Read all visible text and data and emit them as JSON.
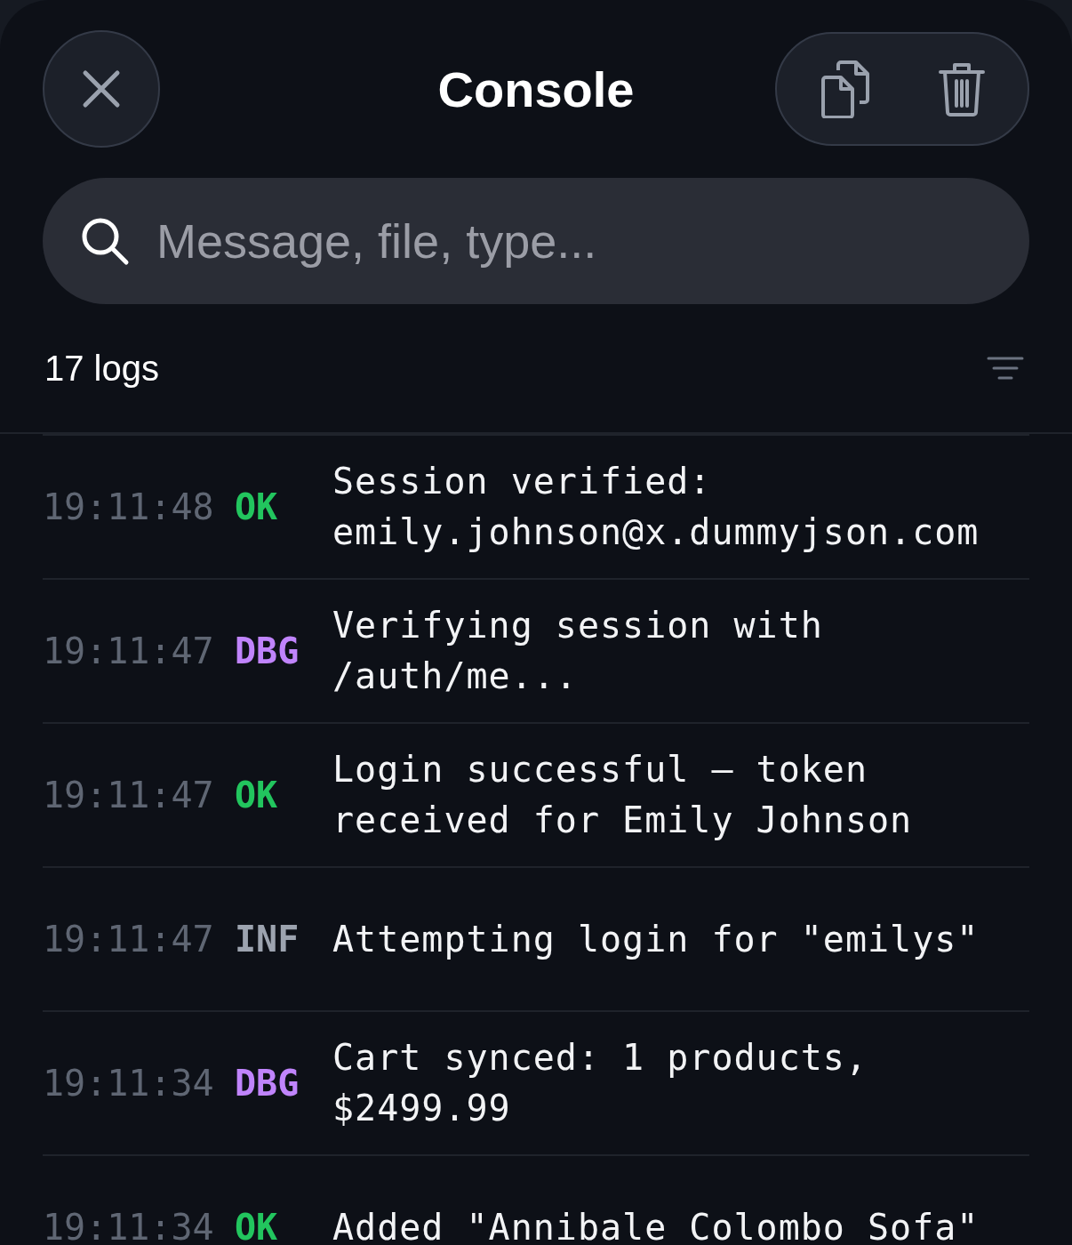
{
  "header": {
    "title": "Console"
  },
  "search": {
    "placeholder": "Message, file, type..."
  },
  "summary": {
    "count": "17 logs"
  },
  "logs": [
    {
      "time": "19:11:48",
      "level": "OK",
      "kind": "ok",
      "message": "Session verified: emily.johnson@x.dummyjson.com"
    },
    {
      "time": "19:11:47",
      "level": "DBG",
      "kind": "debug",
      "message": "Verifying session with /auth/me..."
    },
    {
      "time": "19:11:47",
      "level": "OK",
      "kind": "ok",
      "message": "Login successful — token received for Emily Johnson"
    },
    {
      "time": "19:11:47",
      "level": "INF",
      "kind": "info",
      "message": "Attempting login for \"emilys\""
    },
    {
      "time": "19:11:34",
      "level": "DBG",
      "kind": "debug",
      "message": "Cart synced: 1 products, $2499.99"
    },
    {
      "time": "19:11:34",
      "level": "OK",
      "kind": "ok",
      "message": "Added \"Annibale Colombo Sofa\""
    }
  ]
}
